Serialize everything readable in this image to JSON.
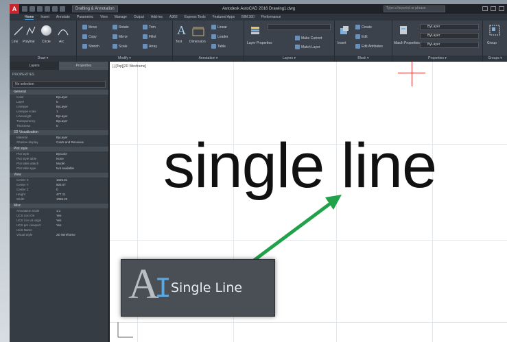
{
  "titlebar": {
    "logo": "A",
    "workspace": "Drafting & Annotation",
    "title": "Autodesk AutoCAD 2016 Drawing1.dwg",
    "search_placeholder": "Type a keyword or phrase"
  },
  "ribbon_tabs": [
    "Home",
    "Insert",
    "Annotate",
    "Parametric",
    "View",
    "Manage",
    "Output",
    "Add-ins",
    "A360",
    "Express Tools",
    "Featured Apps",
    "BIM 360",
    "Performance"
  ],
  "ribbon": {
    "draw": {
      "label": "Draw ▾",
      "tools": [
        "Line",
        "Polyline",
        "Circle",
        "Arc"
      ]
    },
    "modify": {
      "label": "Modify ▾",
      "tools": [
        "Move",
        "Rotate",
        "Trim",
        "Copy",
        "Mirror",
        "Fillet",
        "Stretch",
        "Scale",
        "Array"
      ]
    },
    "annotation": {
      "label": "Annotation ▾",
      "tools": [
        "Text",
        "Dimension",
        "Linear",
        "Leader",
        "Table"
      ]
    },
    "layers": {
      "label": "Layers ▾",
      "tools": [
        "Layer Properties",
        "Make Current",
        "Match Layer"
      ]
    },
    "block": {
      "label": "Block ▾",
      "tools": [
        "Insert",
        "Create",
        "Edit",
        "Edit Attributes"
      ]
    },
    "properties": {
      "label": "Properties ▾",
      "tools": [
        "Match Properties",
        "ByLayer",
        "ByLayer",
        "ByLayer"
      ]
    },
    "groups": {
      "label": "Groups ▾",
      "tools": [
        "Group"
      ]
    }
  },
  "palette": {
    "tabs": [
      "Layers",
      "Properties"
    ],
    "title": "PROPERTIES",
    "selection": "No selection",
    "sections": [
      {
        "name": "General",
        "rows": [
          [
            "Color",
            "ByLayer"
          ],
          [
            "Layer",
            "0"
          ],
          [
            "Linetype",
            "ByLayer"
          ],
          [
            "Linetype scale",
            "1"
          ],
          [
            "Lineweight",
            "ByLayer"
          ],
          [
            "Transparency",
            "ByLayer"
          ],
          [
            "Thickness",
            "0"
          ]
        ]
      },
      {
        "name": "3D Visualization",
        "rows": [
          [
            "Material",
            "ByLayer"
          ],
          [
            "Shadow display",
            "Casts and Receives"
          ]
        ]
      },
      {
        "name": "Plot style",
        "rows": [
          [
            "Plot style",
            "ByColor"
          ],
          [
            "Plot style table",
            "None"
          ],
          [
            "Plot table attach",
            "Model"
          ],
          [
            "Plot table type",
            "Not available"
          ]
        ]
      },
      {
        "name": "View",
        "rows": [
          [
            "Center X",
            "1025.81"
          ],
          [
            "Center Y",
            "503.07"
          ],
          [
            "Center Z",
            "0"
          ],
          [
            "Height",
            "477.11"
          ],
          [
            "Width",
            "1056.23"
          ]
        ]
      },
      {
        "name": "Misc",
        "rows": [
          [
            "Annotation scale",
            "1:1"
          ],
          [
            "UCS icon On",
            "Yes"
          ],
          [
            "UCS icon at origin",
            "Yes"
          ],
          [
            "UCS per viewport",
            "Yes"
          ],
          [
            "UCS Name",
            ""
          ],
          [
            "Visual Style",
            "2D Wireframe"
          ]
        ]
      }
    ]
  },
  "canvas": {
    "viewport_tag": "[-][Top][2D Wireframe]",
    "text": "single line",
    "ucs": "Y\n└─ X"
  },
  "tooltip": {
    "icon": "text-single-line-icon",
    "label": "Single Line"
  },
  "colors": {
    "arrow": "#21a24a",
    "accent": "#3d93d6",
    "cursor": "#5da7e0"
  }
}
